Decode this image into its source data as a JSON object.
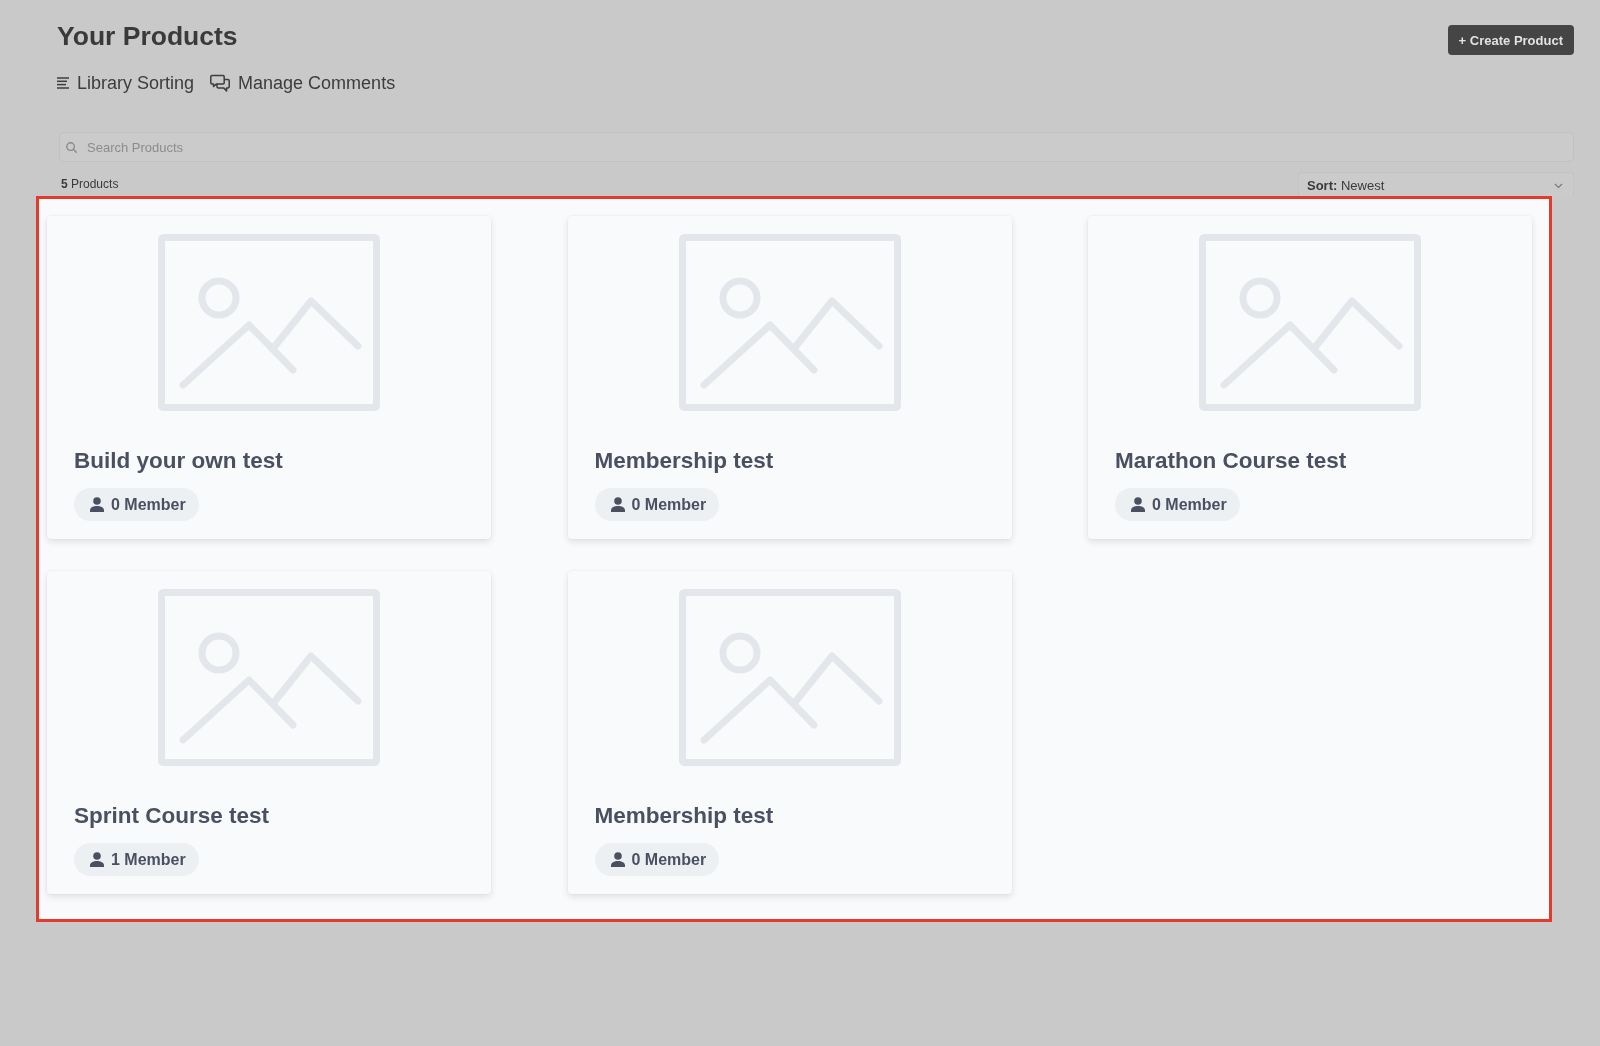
{
  "header": {
    "title": "Your Products",
    "create_button": "+ Create Product",
    "links": [
      {
        "label": "Library Sorting"
      },
      {
        "label": "Manage Comments"
      }
    ]
  },
  "search": {
    "placeholder": "Search Products"
  },
  "product_count": "**5** Products",
  "sort": {
    "label": "**Sort:** Newest"
  },
  "products": [
    {
      "title": "Build your own test",
      "members": "0 Member"
    },
    {
      "title": "Membership test",
      "members": "0 Member"
    },
    {
      "title": "Marathon Course test",
      "members": "0 Member"
    },
    {
      "title": "Sprint Course test",
      "members": "1 Member"
    },
    {
      "title": "Membership test",
      "members": "0 Member"
    }
  ]
}
